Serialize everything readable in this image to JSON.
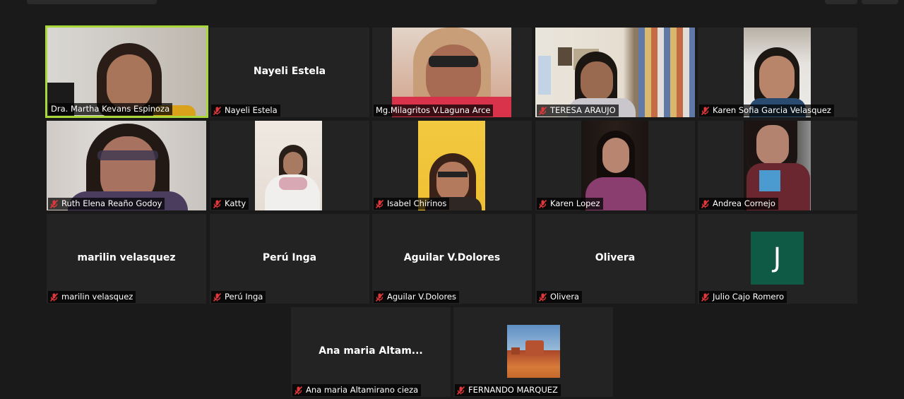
{
  "colors": {
    "background": "#1a1a1a",
    "tile": "#232323",
    "active_speaker_border": "#a9d83a",
    "muted_icon": "#e0383a",
    "avatar_bg": "#0f5a45"
  },
  "participants": [
    {
      "name": "Dra. Martha Kevans Espinoza",
      "video": true,
      "muted": false,
      "active": true
    },
    {
      "name": "Nayeli Estela",
      "display": "Nayeli Estela",
      "video": false,
      "muted": true
    },
    {
      "name": "Mg.Milagritos V.Laguna Arce",
      "video": true,
      "muted": false
    },
    {
      "name": "TERESA ARAUJO",
      "video": true,
      "muted": true
    },
    {
      "name": "Karen Sofia Garcia Velasquez",
      "video": true,
      "muted": true
    },
    {
      "name": "Ruth Elena Reaño Godoy",
      "video": true,
      "muted": true
    },
    {
      "name": "Katty",
      "video": true,
      "muted": true
    },
    {
      "name": "Isabel Chirinos",
      "video": true,
      "muted": true
    },
    {
      "name": "Karen Lopez",
      "video": true,
      "muted": true
    },
    {
      "name": "Andrea Cornejo",
      "video": true,
      "muted": true
    },
    {
      "name": "marilin velasquez",
      "display": "marilin velasquez",
      "video": false,
      "muted": true
    },
    {
      "name": "Perú Inga",
      "display": "Perú Inga",
      "video": false,
      "muted": true
    },
    {
      "name": "Aguilar V.Dolores",
      "display": "Aguilar V.Dolores",
      "video": false,
      "muted": true
    },
    {
      "name": "Olivera",
      "display": "Olivera",
      "video": false,
      "muted": true
    },
    {
      "name": "Julio Cajo Romero",
      "avatar_letter": "J",
      "video": false,
      "muted": true
    },
    {
      "name": "Ana maria Altamirano cieza",
      "display": "Ana maria  Altam...",
      "video": false,
      "muted": true
    },
    {
      "name": "FERNANDO MARQUEZ",
      "video": false,
      "muted": true,
      "profile_picture": "desert-landscape"
    }
  ]
}
